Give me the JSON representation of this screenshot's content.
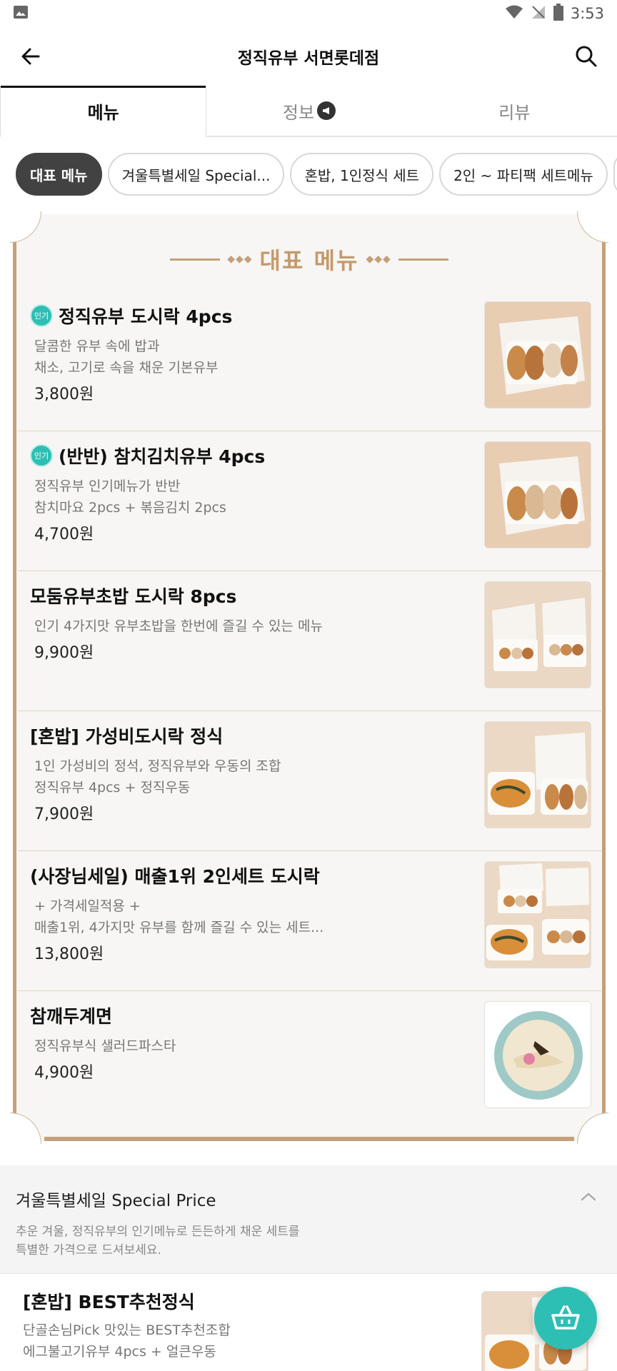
{
  "status_bar": {
    "time": "3:53"
  },
  "header": {
    "title": "정직유부 서면롯데점"
  },
  "tabs": [
    {
      "label": "메뉴",
      "active": true
    },
    {
      "label": "정보",
      "active": false
    },
    {
      "label": "리뷰",
      "active": false
    }
  ],
  "chips": [
    {
      "label": "대표 메뉴",
      "active": true
    },
    {
      "label": "겨울특별세일 Special...",
      "active": false
    },
    {
      "label": "혼밥, 1인정식 세트",
      "active": false
    },
    {
      "label": "2인 ~ 파티팩 세트메뉴",
      "active": false
    }
  ],
  "signature_section": {
    "title": "대표 메뉴",
    "items": [
      {
        "name": "정직유부 도시락 4pcs",
        "badge": "인기",
        "desc": [
          "달콤한 유부 속에 밥과",
          "채소, 고기로 속을 채운 기본유부"
        ],
        "price": "3,800원"
      },
      {
        "name": "(반반) 참치김치유부 4pcs",
        "badge": "인기",
        "desc": [
          "정직유부 인기메뉴가 반반",
          "참치마요 2pcs + 볶음김치 2pcs"
        ],
        "price": "4,700원"
      },
      {
        "name": "모둠유부초밥 도시락 8pcs",
        "badge": "",
        "desc": [
          "인기 4가지맛 유부초밥을 한번에 즐길 수 있는 메뉴"
        ],
        "price": "9,900원"
      },
      {
        "name": "[혼밥] 가성비도시락 정식",
        "badge": "",
        "desc": [
          "1인 가성비의 정석, 정직유부와 우동의 조합",
          "정직유부 4pcs + 정직우동"
        ],
        "price": "7,900원"
      },
      {
        "name": "(사장님세일) 매출1위 2인세트 도시락",
        "badge": "",
        "desc": [
          "+ 가격세일적용 +",
          "매출1위, 4가지맛 유부를 함께 즐길 수 있는 세트..."
        ],
        "price": "13,800원"
      },
      {
        "name": "참깨두계면",
        "badge": "",
        "desc": [
          "정직유부식 샐러드파스타"
        ],
        "price": "4,900원"
      }
    ]
  },
  "special_section": {
    "title": "겨울특별세일 Special Price",
    "desc": [
      "추운 겨울, 정직유부의 인기메뉴로 든든하게 채운 세트를",
      "특별한 가격으로 드셔보세요."
    ],
    "item": {
      "name": "[혼밥] BEST추천정식",
      "desc": [
        "단골손님Pick 맛있는 BEST추천조합",
        "에그불고기유부 4pcs + 얼큰우동"
      ]
    }
  },
  "colors": {
    "accent_teal": "#2dbfb3",
    "gold": "#c4a07a",
    "chip_active": "#424242"
  }
}
